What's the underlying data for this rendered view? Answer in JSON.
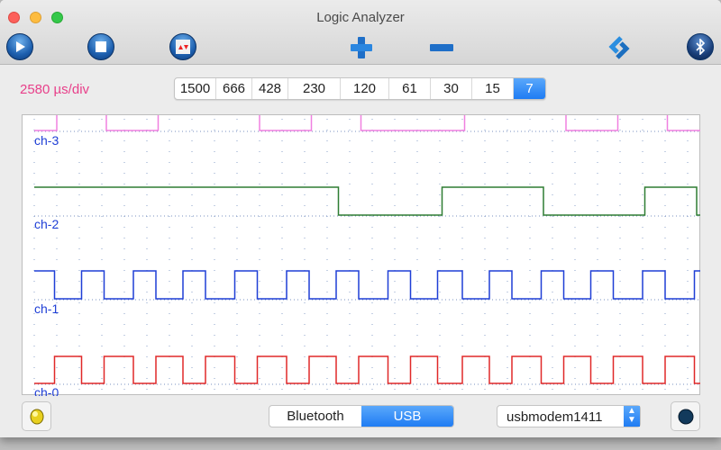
{
  "window": {
    "title": "Logic Analyzer"
  },
  "toolbar": {
    "icons": [
      "play-icon",
      "stop-icon",
      "trigger-icon",
      "zoom-in-plus-icon",
      "zoom-out-minus-icon",
      "sync-icon",
      "bluetooth-icon"
    ]
  },
  "timebase": {
    "label": "2580 µs/div",
    "color": "#e8408a",
    "options": [
      "1500",
      "666",
      "428",
      "230",
      "120",
      "61",
      "30",
      "15",
      "7"
    ],
    "selected": "7"
  },
  "chart_data": {
    "type": "line",
    "x_unit": "div",
    "xlim": [
      0,
      29.6
    ],
    "grid": true,
    "series": [
      {
        "name": "ch-3",
        "color": "#f080e0",
        "initial": 0,
        "edges": [
          1.0,
          3.2,
          5.5,
          10.0,
          12.3,
          14.5,
          19.1,
          23.6,
          25.9,
          28.1
        ]
      },
      {
        "name": "ch-2",
        "color": "#2e7d32",
        "initial": 1,
        "edges": [
          13.5,
          18.1,
          22.6,
          27.1,
          29.4
        ]
      },
      {
        "name": "ch-1",
        "color": "#1f3fd6",
        "initial": 1,
        "edges": [
          0.9,
          2.1,
          3.1,
          4.4,
          5.4,
          6.6,
          7.6,
          8.9,
          9.9,
          11.2,
          12.2,
          13.4,
          14.4,
          15.7,
          16.7,
          17.9,
          19.0,
          20.2,
          21.2,
          22.5,
          23.5,
          24.7,
          25.7,
          27.0,
          28.0,
          29.3
        ]
      },
      {
        "name": "ch-0",
        "color": "#e02828",
        "initial": 0,
        "edges": [
          0.9,
          2.1,
          3.1,
          4.4,
          5.4,
          6.6,
          7.6,
          8.9,
          9.9,
          11.2,
          12.2,
          13.4,
          14.4,
          15.7,
          16.7,
          17.9,
          19.0,
          20.2,
          21.2,
          22.5,
          23.5,
          24.7,
          25.7,
          27.0,
          28.0,
          29.3
        ]
      }
    ]
  },
  "bottom": {
    "connection": {
      "options": [
        "Bluetooth",
        "USB"
      ],
      "selected": "USB"
    },
    "port": "usbmodem1411",
    "led_icon": "yellow-led-icon",
    "status_icon": "dark-led-icon"
  }
}
